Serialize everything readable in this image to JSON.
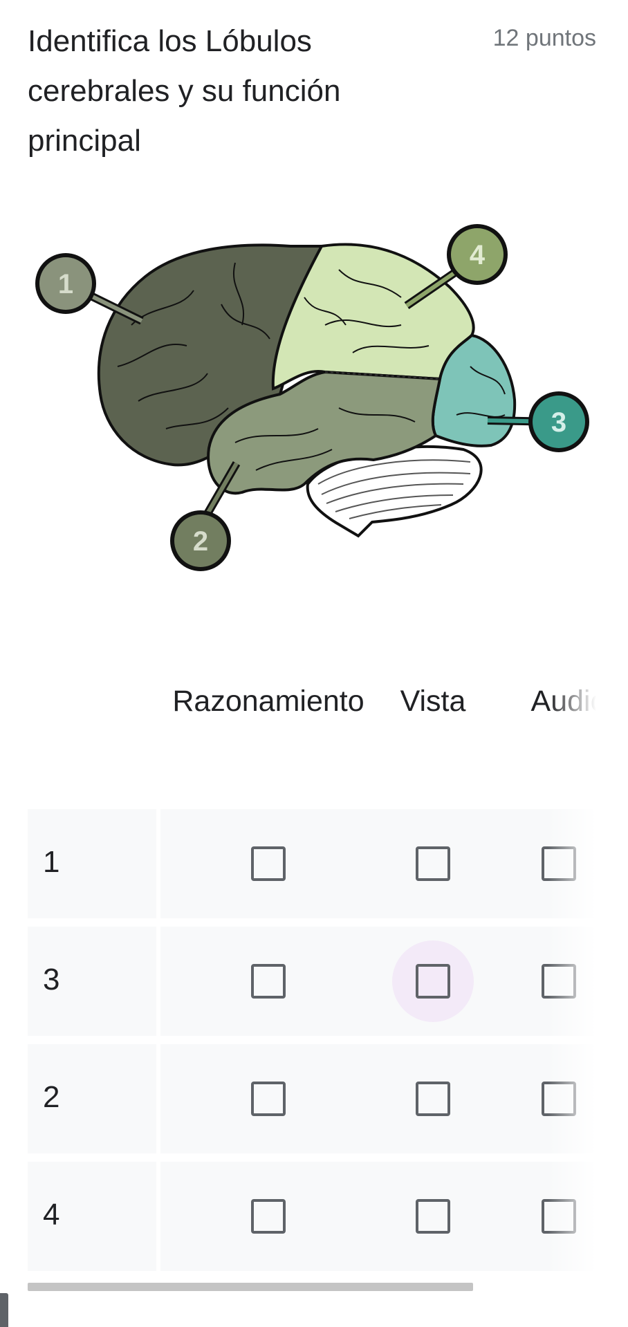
{
  "question": {
    "title": "Identifica los Lóbulos cerebrales y su función principal",
    "points": "12 puntos"
  },
  "diagram": {
    "labels": [
      "1",
      "2",
      "3",
      "4"
    ],
    "colors": {
      "frontal": "#5c6350",
      "temporal": "#8c9a7c",
      "parietal": "#d3e6b5",
      "occipital": "#7ec4b8",
      "cerebellum": "#ffffff",
      "marker_1": "#8a937c",
      "marker_2": "#727e60",
      "marker_3": "#3a9a89",
      "marker_4": "#8ea56a"
    }
  },
  "grid": {
    "columns": [
      "Razonamiento",
      "Vista",
      "Audición"
    ],
    "rows": [
      {
        "label": "1",
        "checked": [
          false,
          false,
          false
        ]
      },
      {
        "label": "3",
        "checked": [
          false,
          false,
          false
        ],
        "focused_col": 1
      },
      {
        "label": "2",
        "checked": [
          false,
          false,
          false
        ]
      },
      {
        "label": "4",
        "checked": [
          false,
          false,
          false
        ]
      }
    ]
  }
}
